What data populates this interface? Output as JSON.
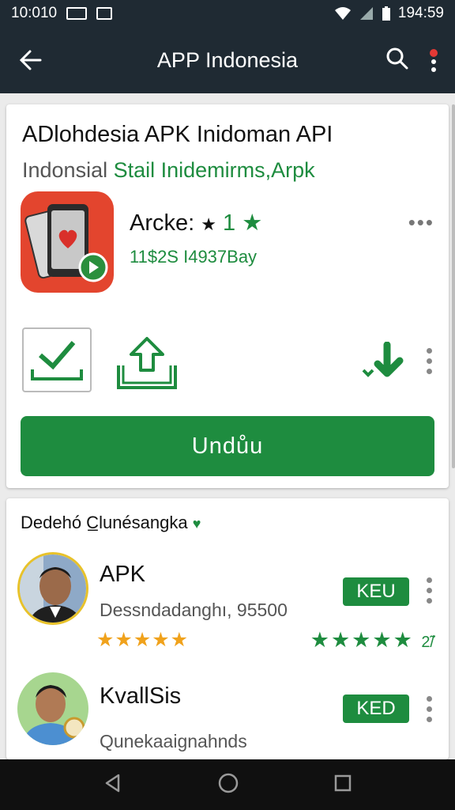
{
  "status_bar": {
    "left_time": "10:010",
    "right_time": "194:59"
  },
  "app_bar": {
    "title": "APP Indonesia",
    "back_icon": "arrow-left-icon",
    "search_icon": "search-icon",
    "menu_icon": "overflow-menu-icon",
    "notification_color": "#e53935"
  },
  "app_card": {
    "headline": "ADlohdesia APK Inidoman API",
    "subline_prefix": "Indonsial",
    "subline_green": "Stail Inidemirms,Arpk",
    "app_name": "Arcke:",
    "app_name_star": "★",
    "app_name_suffix": "1",
    "price_line": "11$2S I4937Bay",
    "download_label": "Undůu",
    "actions": [
      "check-install-icon",
      "share-upload-icon",
      "wishlist-icon"
    ]
  },
  "related_section": {
    "title": "Dedehó C̲lunésangka",
    "items": [
      {
        "name": "APK",
        "description": "Dessndadanghı, 95500",
        "badge": "KEU",
        "rating_green": "★★★★★",
        "rating_count": "2̃/",
        "rating_gold": "★★★★★"
      },
      {
        "name": "KvallSis",
        "description": "Qunekaaignahnds",
        "badge": "KED"
      }
    ]
  },
  "colors": {
    "primary_green": "#1e8c3f",
    "app_bar": "#1f2a33",
    "app_icon_bg": "#e3452e",
    "star_gold": "#f0a21c"
  }
}
